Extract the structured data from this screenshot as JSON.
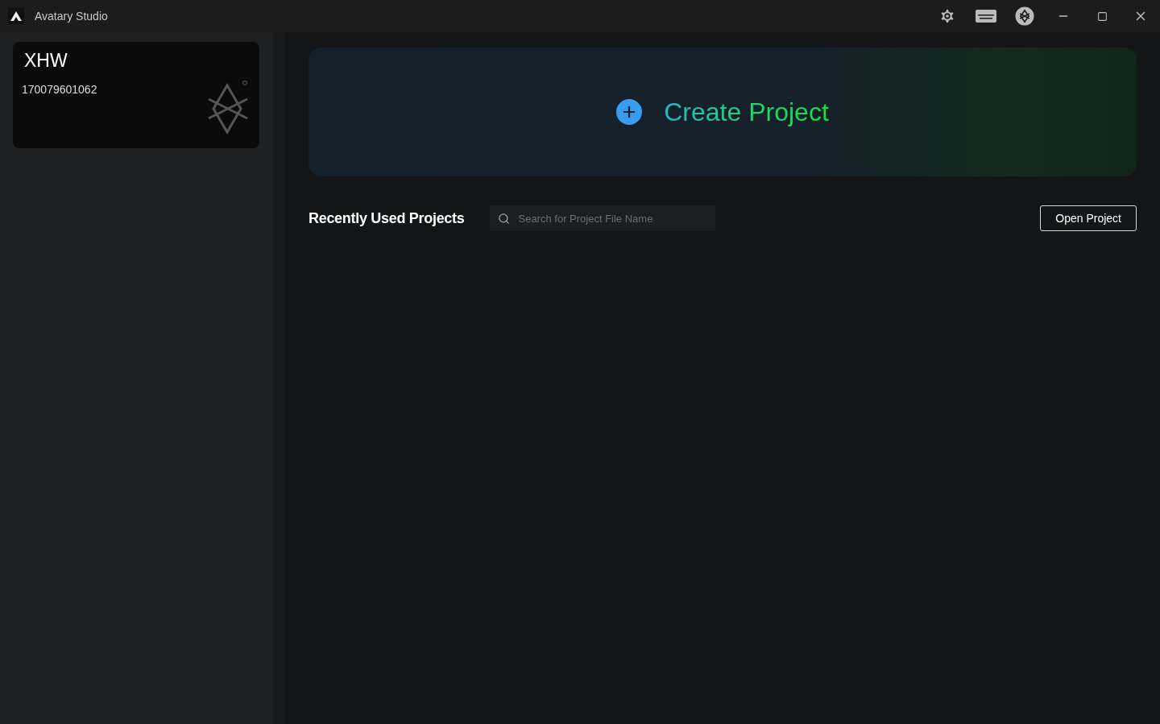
{
  "window": {
    "title": "Avatary Studio"
  },
  "account": {
    "name": "XHW",
    "id": "170079601062"
  },
  "create": {
    "label": "Create Project"
  },
  "recent": {
    "title": "Recently Used Projects",
    "search": {
      "placeholder": "Search for Project File Name"
    },
    "open_button": "Open Project"
  }
}
